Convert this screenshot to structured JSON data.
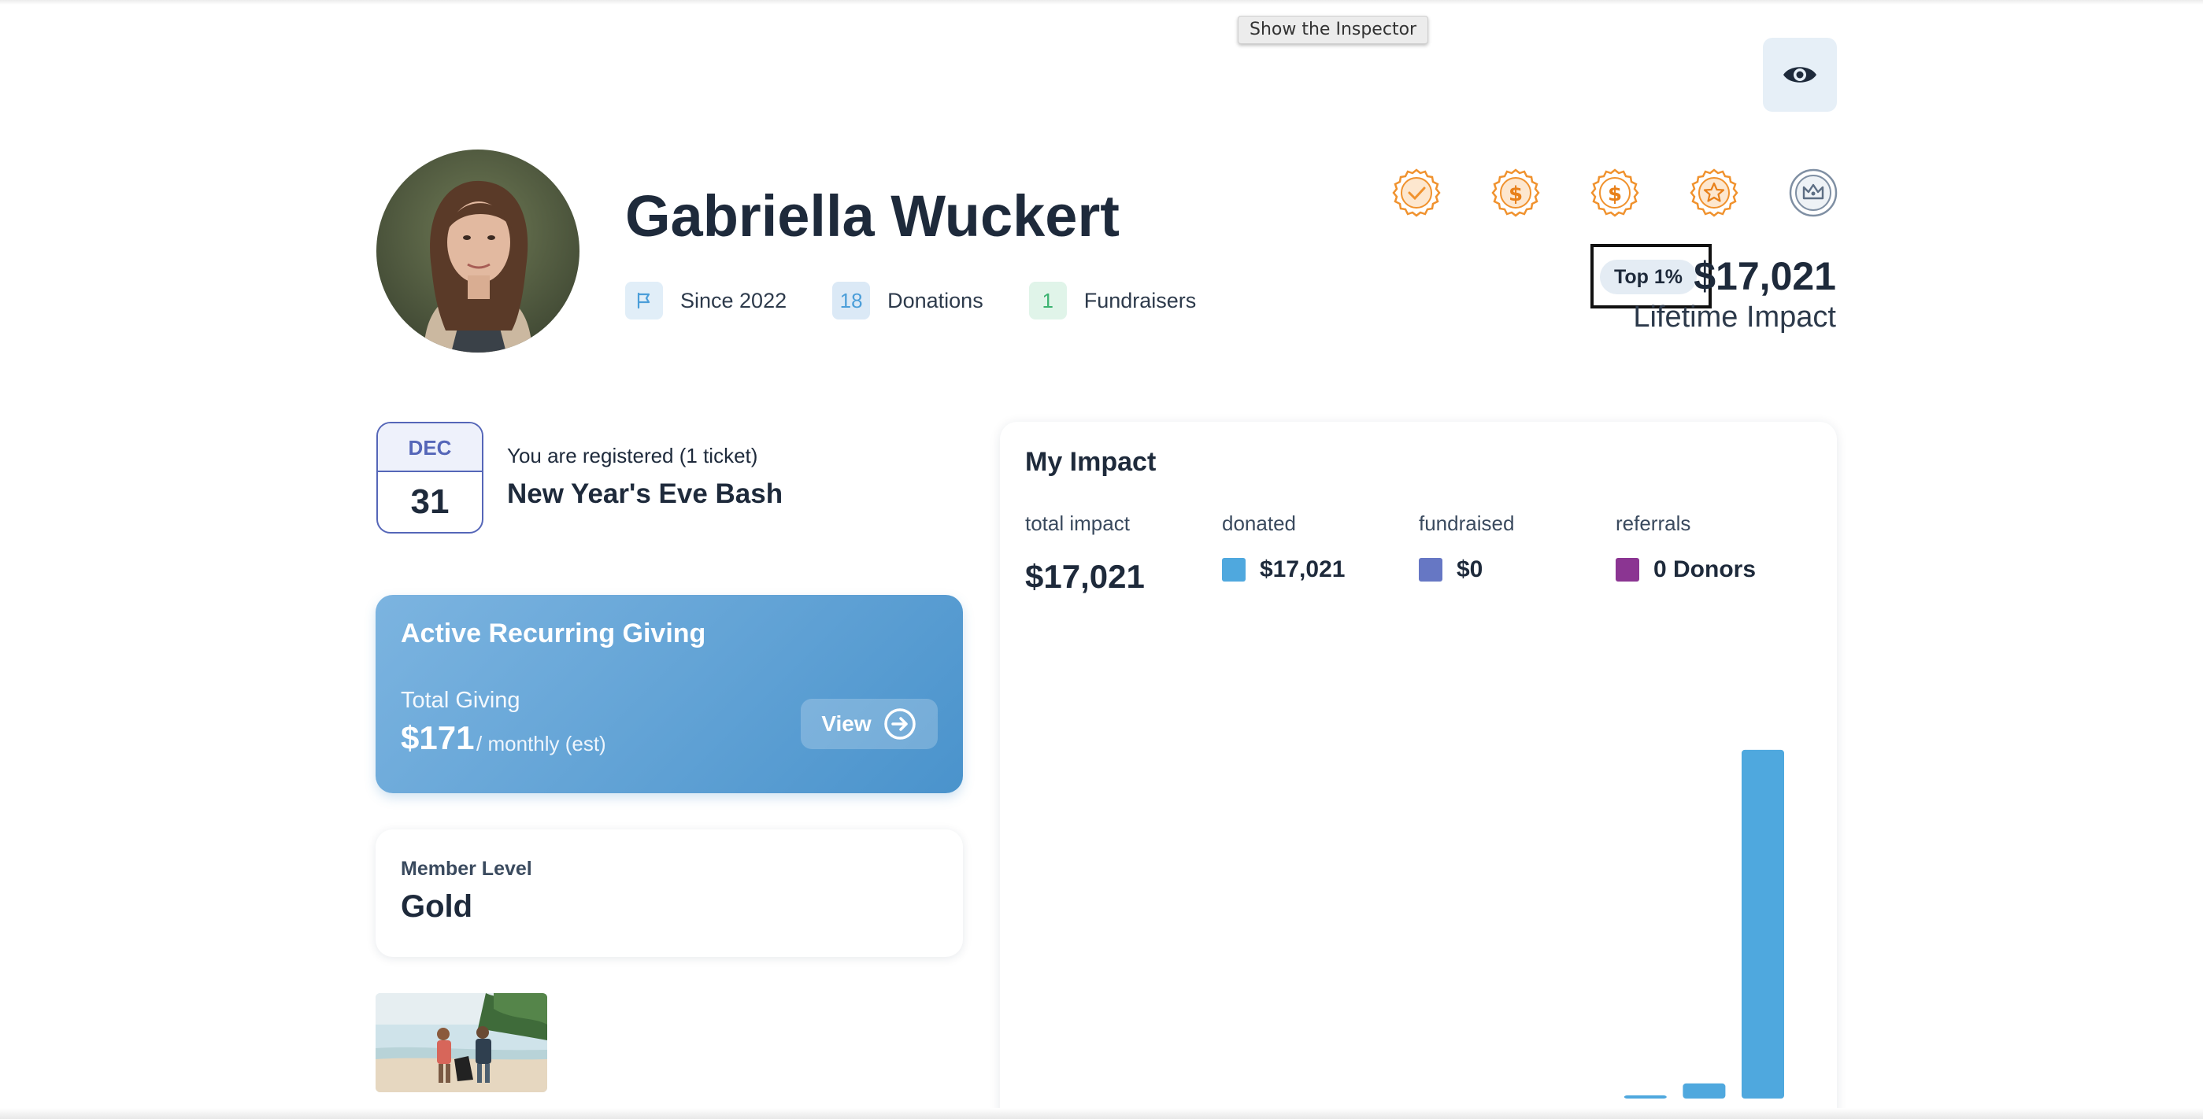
{
  "tooltip": {
    "text": "Show the Inspector"
  },
  "inspector_button": {
    "icon": "eye-icon"
  },
  "profile": {
    "name": "Gabriella Wuckert",
    "since": "Since 2022",
    "donations_count": "18",
    "donations_label": "Donations",
    "fundraisers_count": "1",
    "fundraisers_label": "Fundraisers",
    "top_badge": "Top 1%",
    "lifetime_amount": "$17,021",
    "lifetime_label": "Lifetime Impact",
    "badges": [
      {
        "icon": "check-badge-icon",
        "color": "#f0922e"
      },
      {
        "icon": "dollar-badge-icon",
        "color": "#f0922e"
      },
      {
        "icon": "dollar-badge-icon",
        "color": "#f0922e"
      },
      {
        "icon": "star-badge-icon",
        "color": "#f0922e"
      },
      {
        "icon": "crown-badge-icon",
        "color": "#7f8fa3"
      }
    ]
  },
  "event": {
    "month": "DEC",
    "day": "31",
    "status": "You are registered (1 ticket)",
    "title": "New Year's Eve Bash"
  },
  "recurring": {
    "title": "Active Recurring Giving",
    "sub_label": "Total Giving",
    "amount": "$171",
    "unit": "/ monthly (est)",
    "view_label": "View"
  },
  "member": {
    "label": "Member Level",
    "value": "Gold"
  },
  "impact": {
    "title": "My Impact",
    "total_label": "total impact",
    "total_value": "$17,021",
    "donated_label": "donated",
    "donated_value": "$17,021",
    "fundraised_label": "fundraised",
    "fundraised_value": "$0",
    "referrals_label": "referrals",
    "referrals_value": "0 Donors",
    "colors": {
      "donated": "#4fa8de",
      "fundraised": "#6677c4",
      "referrals": "#8b3592"
    }
  },
  "chart_data": {
    "type": "bar",
    "categories": [
      "",
      "",
      "",
      "",
      "",
      "",
      "",
      "",
      "",
      "",
      "",
      "",
      ""
    ],
    "series": [
      {
        "values": [
          0,
          0,
          0,
          0,
          0,
          0,
          0,
          0,
          0,
          0,
          130,
          700,
          16190
        ]
      }
    ],
    "ylim": [
      0,
      19000
    ],
    "grid": false,
    "color": "#4fa8de"
  }
}
